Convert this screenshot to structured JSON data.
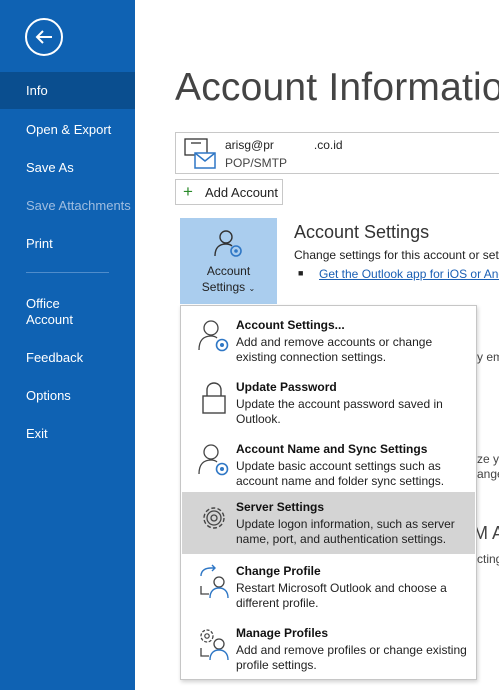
{
  "sidebar": {
    "items": [
      {
        "label": "Info",
        "active": true
      },
      {
        "label": "Open & Export"
      },
      {
        "label": "Save As"
      },
      {
        "label": "Save Attachments",
        "disabled": true
      },
      {
        "label": "Print"
      },
      {
        "label": "Office\nAccount"
      },
      {
        "label": "Feedback"
      },
      {
        "label": "Options"
      },
      {
        "label": "Exit"
      }
    ]
  },
  "main": {
    "title": "Account Informatio",
    "account": {
      "email": "arisg@pr            .co.id",
      "type": "POP/SMTP"
    },
    "add_account_label": "Add Account",
    "account_settings_button": "Account\nSettings",
    "section_title": "Account Settings",
    "section_desc": "Change settings for this account or set",
    "section_link": "Get the Outlook app for iOS or And",
    "fragments": [
      "y em",
      "ze yo",
      "ange",
      "M A",
      "cting"
    ]
  },
  "menu": {
    "items": [
      {
        "title": "Account Settings...",
        "desc": "Add and remove accounts or change existing connection settings.",
        "icon": "account-settings-icon"
      },
      {
        "title": "Update Password",
        "desc": "Update the account password saved in Outlook.",
        "icon": "lock-icon"
      },
      {
        "title": "Account Name and Sync Settings",
        "desc": "Update basic account settings such as account name and folder sync settings.",
        "icon": "account-sync-icon"
      },
      {
        "title": "Server Settings",
        "desc": "Update logon information, such as server name, port, and authentication settings.",
        "icon": "gear-icon",
        "highlighted": true
      },
      {
        "title": "Change Profile",
        "desc": "Restart Microsoft Outlook and choose a different profile.",
        "icon": "change-profile-icon"
      },
      {
        "title": "Manage Profiles",
        "desc": "Add and remove profiles or change existing profile settings.",
        "icon": "manage-profiles-icon"
      }
    ]
  },
  "colors": {
    "sidebar": "#0f62b3",
    "active": "#0a4e8f",
    "accent": "#aacdee",
    "highlight": "#d4d4d4"
  }
}
